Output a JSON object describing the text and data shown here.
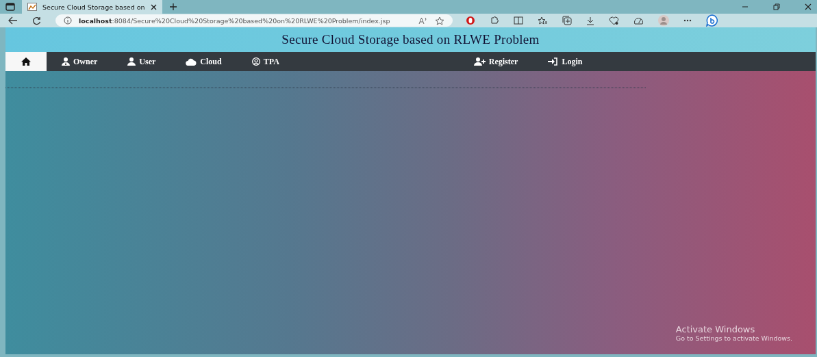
{
  "browser": {
    "tab_title": "Secure Cloud Storage based on",
    "url_host": "localhost",
    "url_path": ":8084/Secure%20Cloud%20Storage%20based%20on%20RLWE%20Problem/index.jsp"
  },
  "page": {
    "title": "Secure Cloud Storage based on RLWE Problem"
  },
  "nav": {
    "left": [
      {
        "selected": true
      },
      {
        "label": "Owner",
        "selected": false
      },
      {
        "label": "User",
        "selected": false
      },
      {
        "label": "Cloud",
        "selected": false
      },
      {
        "label": "TPA",
        "selected": false
      }
    ],
    "right": [
      {
        "label": "Register",
        "selected": false
      },
      {
        "label": "Login",
        "selected": false
      }
    ]
  },
  "activation_notice": {
    "title": "Activate Windows",
    "subtitle": "Go to Settings to activate Windows."
  }
}
